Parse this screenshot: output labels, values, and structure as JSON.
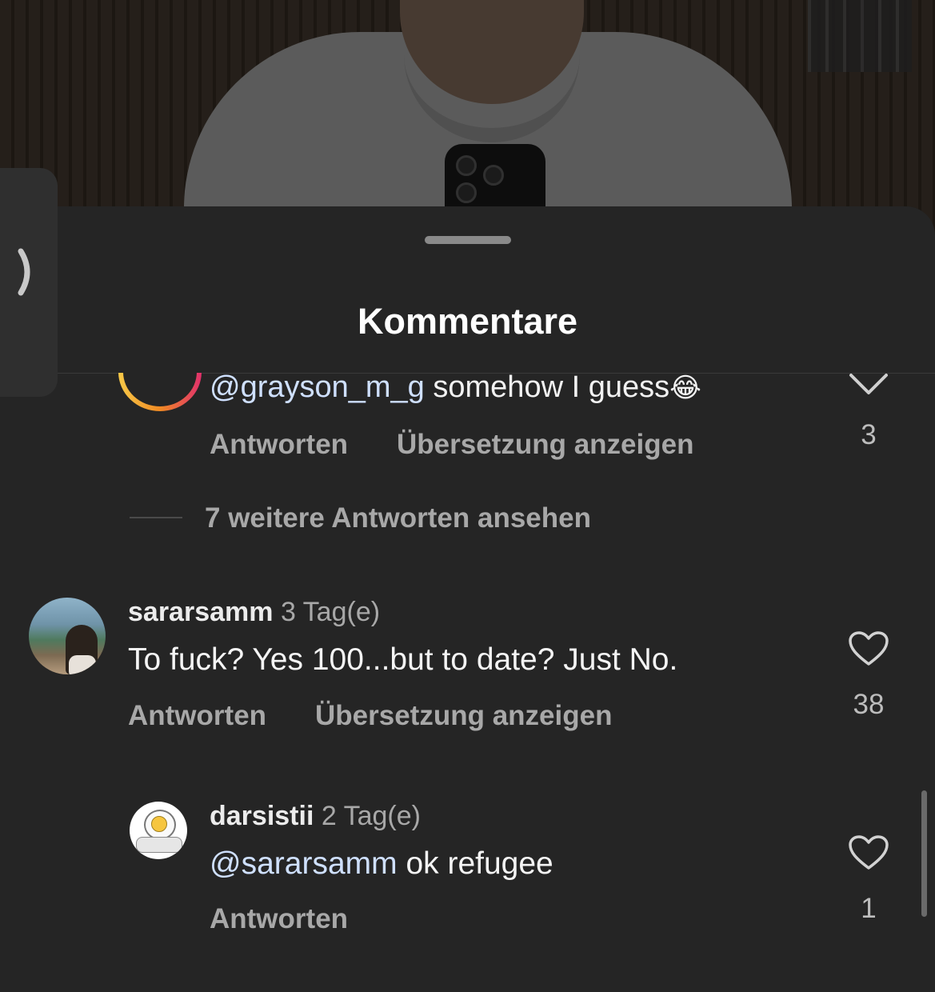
{
  "sheet": {
    "title": "Kommentare"
  },
  "comments": [
    {
      "mention": "@grayson_m_g",
      "text": " somehow I guess",
      "emoji": "😂",
      "reply_label": "Antworten",
      "translate_label": "Übersetzung anzeigen",
      "likes": "3",
      "like_icon": "chevron-down-icon"
    },
    {
      "view_more_label": "7 weitere Antworten ansehen"
    },
    {
      "username": "sararsamm",
      "time": "3 Tag(e)",
      "text": "To fuck? Yes 100...but to date? Just No.",
      "reply_label": "Antworten",
      "translate_label": "Übersetzung anzeigen",
      "likes": "38",
      "like_icon": "heart-outline-icon"
    },
    {
      "username": "darsistii",
      "time": "2 Tag(e)",
      "mention": "@sararsamm",
      "text": " ok refugee",
      "reply_label": "Antworten",
      "likes": "1",
      "like_icon": "heart-outline-icon"
    }
  ],
  "colors": {
    "sheet_bg": "#252525",
    "mention": "#cfe0ff",
    "muted": "#a8a8a8",
    "story_ring": "#f5a623"
  }
}
